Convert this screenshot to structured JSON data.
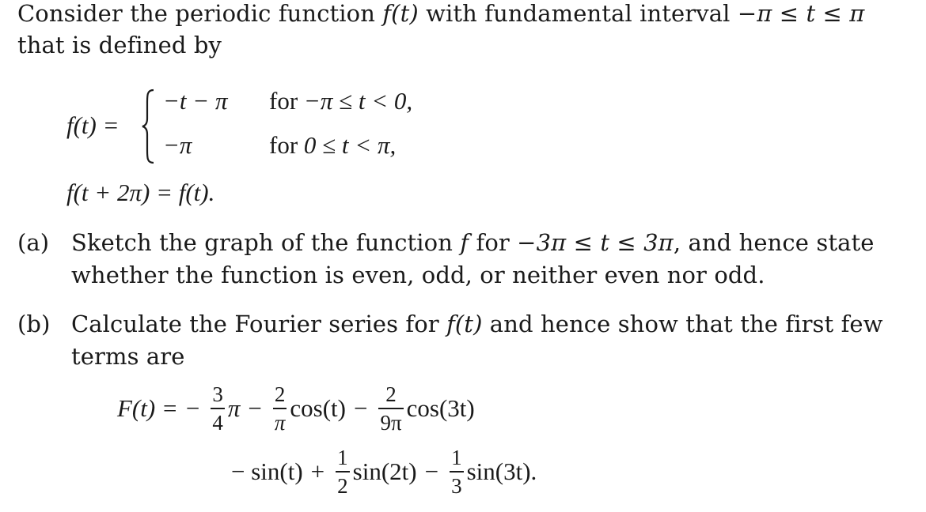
{
  "intro": {
    "line1_text": "Consider the periodic function ",
    "line1_func": "f(t)",
    "line1_text2": " with fundamental interval ",
    "line1_interval": "−π ≤ t ≤ π",
    "line2_text": "that is defined by"
  },
  "definition": {
    "lhs": "f(t) =",
    "cases": [
      {
        "expr": "−t − π",
        "cond_word": "for",
        "cond": "−π ≤ t < 0,"
      },
      {
        "expr": "−π",
        "cond_word": "for",
        "cond": "0 ≤ t < π,"
      }
    ],
    "periodicity": "f(t + 2π) = f(t)."
  },
  "part_a": {
    "label": "(a)",
    "line1_text": "Sketch the graph of the function ",
    "line1_func": "f",
    "line1_text2": " for ",
    "line1_range": "−3π ≤ t ≤ 3π",
    "line1_text3": ", and hence state",
    "line2_text": "whether the function is even, odd, or neither even nor odd."
  },
  "part_b": {
    "label": "(b)",
    "line1_text": "Calculate the Fourier series for ",
    "line1_func": "f(t)",
    "line1_text2": " and hence show that the first few",
    "line2_text": "terms are"
  },
  "series": {
    "lhs": "F(t) =",
    "line1": {
      "sign0": "−",
      "frac1": {
        "num": "3",
        "den": "4"
      },
      "after1": "π",
      "op1": "−",
      "frac2": {
        "num": "2",
        "den": "π"
      },
      "after2": "cos(t)",
      "op2": "−",
      "frac3": {
        "num": "2",
        "den": "9π"
      },
      "after3": "cos(3t)"
    },
    "line2": {
      "lead": "− sin(t)",
      "op1": "+",
      "frac1": {
        "num": "1",
        "den": "2"
      },
      "after1": "sin(2t)",
      "op2": "−",
      "frac2": {
        "num": "1",
        "den": "3"
      },
      "after2": "sin(3t)."
    }
  }
}
